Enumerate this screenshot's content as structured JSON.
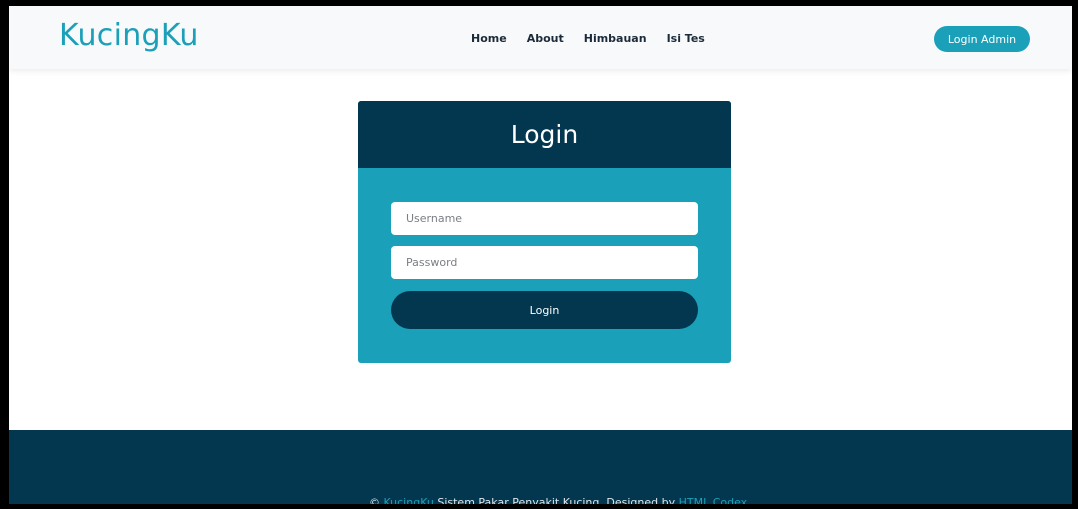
{
  "colors": {
    "accent": "#1ba0b9",
    "dark": "#02374f",
    "navbar_bg": "#f8f9fa"
  },
  "navbar": {
    "brand": "KucingKu",
    "links": [
      {
        "label": "Home"
      },
      {
        "label": "About"
      },
      {
        "label": "Himbauan"
      },
      {
        "label": "Isi Tes"
      }
    ],
    "admin_button": "Login Admin"
  },
  "login": {
    "title": "Login",
    "username_placeholder": "Username",
    "password_placeholder": "Password",
    "submit_label": "Login"
  },
  "footer": {
    "copyright_symbol": "©",
    "brand_link": "KucingKu",
    "text_middle": "Sistem Pakar Penyakit Kucing. Designed by",
    "designer_link": "HTML Codex"
  }
}
